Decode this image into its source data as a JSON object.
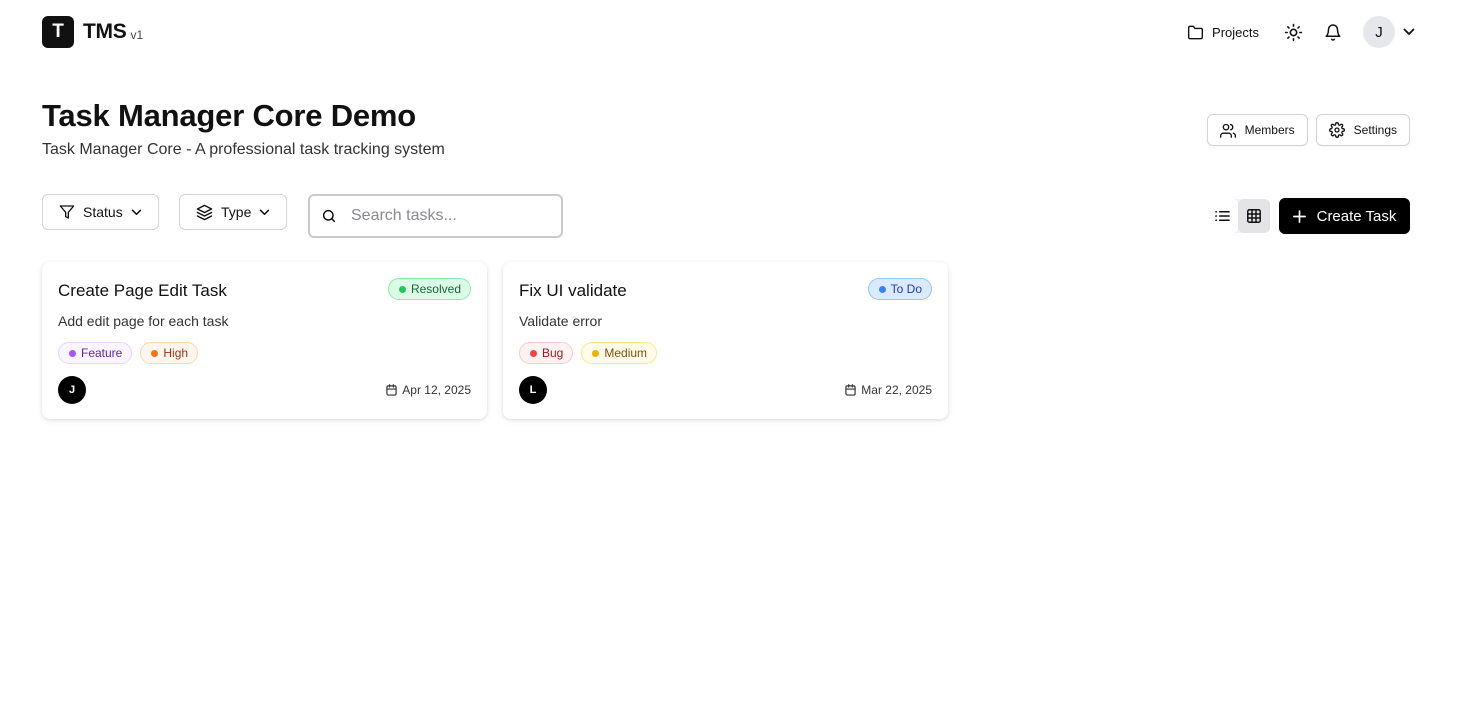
{
  "app": {
    "logo_letter": "T",
    "name": "TMS",
    "version": "v1"
  },
  "header": {
    "projects_label": "Projects",
    "user_initial": "J",
    "icons": [
      "folder-icon",
      "sun-icon",
      "bell-icon",
      "chevron-down-icon"
    ]
  },
  "page": {
    "title": "Task Manager Core Demo",
    "subtitle": "Task Manager Core - A professional task tracking system",
    "members_label": "Members",
    "settings_label": "Settings"
  },
  "toolbar": {
    "status_filter_label": "Status",
    "type_filter_label": "Type",
    "search_placeholder": "Search tasks...",
    "search_value": "",
    "view_modes": [
      "list",
      "grid"
    ],
    "active_view": "grid",
    "create_label": "Create Task"
  },
  "tasks": [
    {
      "title": "Create Page Edit Task",
      "description": "Add edit page for each task",
      "status": "Resolved",
      "type": "Feature",
      "priority": "High",
      "assignee_initial": "J",
      "due_date": "Apr 12, 2025"
    },
    {
      "title": "Fix UI validate",
      "description": "Validate error",
      "status": "To Do",
      "type": "Bug",
      "priority": "Medium",
      "assignee_initial": "L",
      "due_date": "Mar 22, 2025"
    }
  ],
  "colors": {
    "primary": "#000000",
    "resolved": "#22c55e",
    "todo": "#3b82f6",
    "feature": "#a855f7",
    "bug": "#ef4444",
    "high": "#f97316",
    "medium": "#eab308"
  }
}
